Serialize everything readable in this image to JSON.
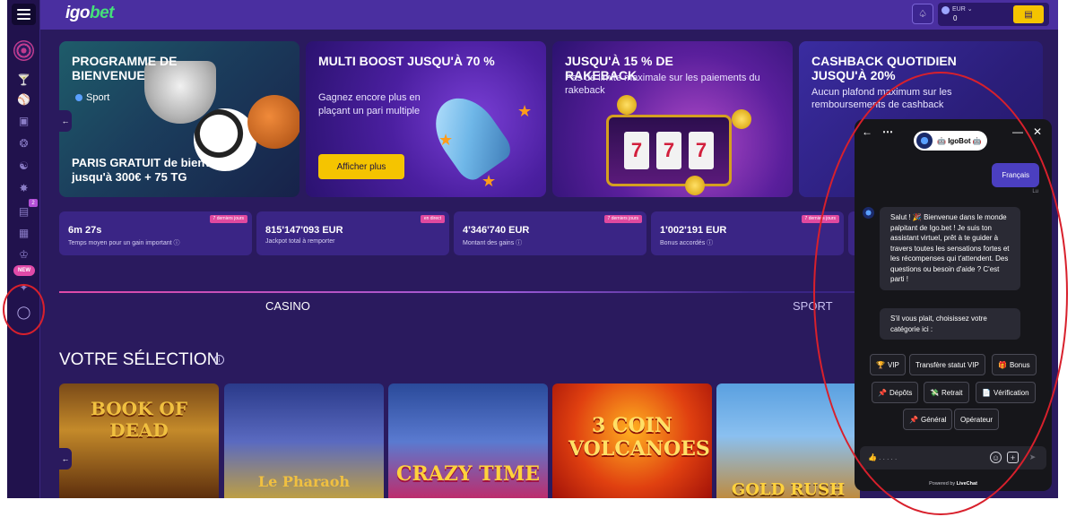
{
  "header": {
    "logo_main": "igo",
    "logo_accent": "bet",
    "wallet_currency": "EUR",
    "wallet_amount": "0"
  },
  "sidebar": {
    "new_badge": "NEW",
    "count_badge": "2"
  },
  "promos": [
    {
      "title": "PROGRAMME DE BIENVENUE",
      "tag": "Sport",
      "desc": "PARIS GRATUIT de bienvenue jusqu'à 300€ + 75 TG"
    },
    {
      "title": "MULTI BOOST JUSQU'À 70 %",
      "desc": "Gagnez encore plus en plaçant un pari multiple",
      "button": "Afficher plus"
    },
    {
      "title": "JUSQU'À 15 % DE RAKEBACK",
      "desc": "Pas de limite maximale sur les paiements du rakeback"
    },
    {
      "title": "CASHBACK QUOTIDIEN JUSQU'À 20%",
      "desc": "Aucun plafond maximum sur les remboursements de cashback"
    }
  ],
  "stats": [
    {
      "value": "6m 27s",
      "label": "Temps moyen pour un gain important",
      "badge": "7 derniers jours"
    },
    {
      "value": "815'147'093 EUR",
      "label": "Jackpot total à remporter",
      "badge": "en direct"
    },
    {
      "value": "4'346'740 EUR",
      "label": "Montant des gains",
      "badge": "7 derniers jours"
    },
    {
      "value": "1'002'191 EUR",
      "label": "Bonus accordés",
      "badge": "7 derniers jours"
    }
  ],
  "tabs": [
    "CASINO",
    "SPORT"
  ],
  "section": {
    "title": "VOTRE SÉLECTION"
  },
  "games": [
    {
      "title": "BOOK OF DEAD"
    },
    {
      "title": "Le Pharaoh"
    },
    {
      "title": "CRAZY TIME"
    },
    {
      "title": "3 COIN VOLCANOES"
    },
    {
      "title": "GOLD RUSH"
    }
  ],
  "chat": {
    "agent_name": "IgoBot",
    "user_message": "Français",
    "status": "Lu",
    "bot_message_1": "Salut ! 🎉 Bienvenue dans le monde palpitant de Igo.bet ! Je suis ton assistant virtuel, prêt à te guider à travers toutes les sensations fortes et les récompenses qui t'attendent. Des questions ou besoin d'aide ? C'est parti !",
    "bot_message_2": "S'il vous plait, choisissez votre catégorie ici :",
    "quick_replies": [
      "VIP",
      "Transfère statut VIP",
      "Bonus",
      "Dépôts",
      "Retrait",
      "Vérification",
      "Général",
      "Opérateur"
    ],
    "input_placeholder": "👍 . . . . .",
    "footer_prefix": "Powered by",
    "footer_brand": "LiveChat"
  }
}
